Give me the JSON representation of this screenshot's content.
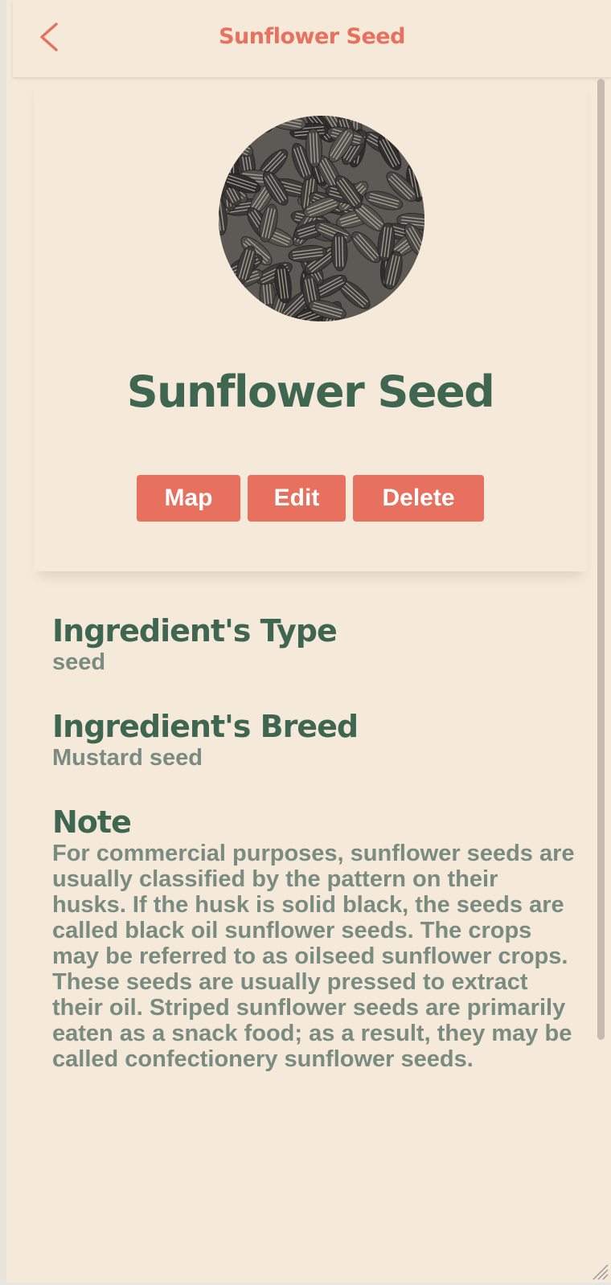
{
  "header": {
    "title": "Sunflower Seed",
    "back_icon": "chevron-left-icon"
  },
  "ingredient": {
    "image": "sunflower-seeds-photo",
    "name": "Sunflower Seed"
  },
  "actions": {
    "map_label": "Map",
    "edit_label": "Edit",
    "delete_label": "Delete"
  },
  "details": {
    "type_heading": "Ingredient's Type",
    "type_value": "seed",
    "breed_heading": "Ingredient's Breed",
    "breed_value": "Mustard seed",
    "note_heading": "Note",
    "note_text": "For commercial purposes, sunflower seeds are usually classified by the pattern on their husks. If the husk is solid black, the seeds are called black oil sunflower seeds. The crops may be referred to as oilseed sunflower crops. These seeds are usually pressed to extract their oil. Striped sunflower seeds are primarily eaten as a snack food; as a result, they may be called confectionery sunflower seeds."
  },
  "colors": {
    "background": "#f5e9d9",
    "accent": "#e8705f",
    "heading": "#3f6651",
    "text_muted": "#7a8b81"
  }
}
